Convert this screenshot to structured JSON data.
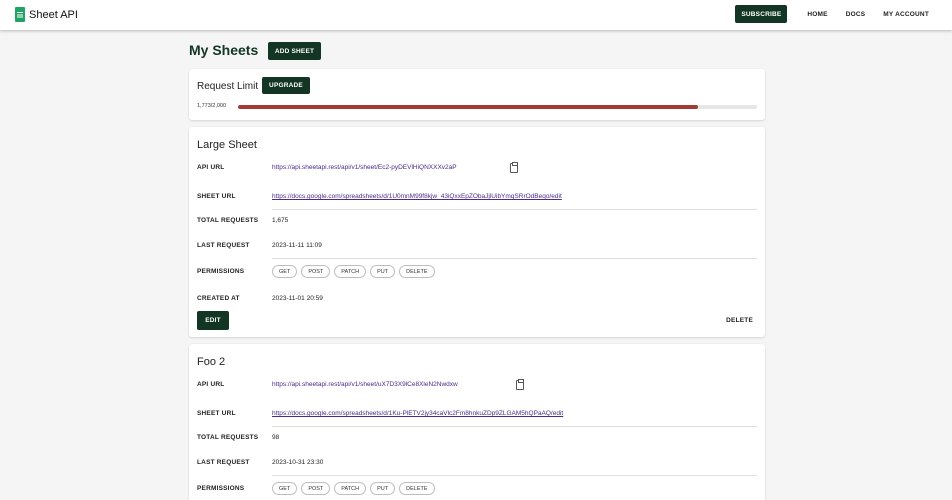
{
  "app": {
    "name": "Sheet API",
    "icon": "sheets-icon"
  },
  "nav": {
    "subscribe": "SUBSCRIBE",
    "home": "HOME",
    "docs": "DOCS",
    "account": "MY ACCOUNT"
  },
  "page": {
    "title": "My Sheets",
    "add_sheet": "ADD SHEET"
  },
  "limit": {
    "label": "Request Limit",
    "upgrade": "UPGRADE",
    "count_text": "1,773/2,000",
    "used": 1773,
    "max": 2000,
    "bar_color": "#a23a36"
  },
  "labels": {
    "api_url": "API URL",
    "sheet_url": "SHEET URL",
    "total_requests": "TOTAL REQUESTS",
    "last_request": "LAST REQUEST",
    "permissions": "PERMISSIONS",
    "created_at": "CREATED AT",
    "edit": "EDIT",
    "delete": "DELETE"
  },
  "sheets": [
    {
      "name": "Large Sheet",
      "api_url": "https://api.sheetapi.rest/api/v1/sheet/Ec2-pyDEVlHiQNXXXv2aP",
      "sheet_url": "https://docs.google.com/spreadsheets/d/1U0mnM99f8kjw_43iQxxEpZObaJjlUibYmqSRrOdBeqo/edit",
      "total_requests": "1,675",
      "last_request": "2023-11-11 11:09",
      "permissions": [
        "GET",
        "POST",
        "PATCH",
        "PUT",
        "DELETE"
      ],
      "created_at": "2023-11-01 20:59"
    },
    {
      "name": "Foo 2",
      "api_url": "https://api.sheetapi.rest/api/v1/sheet/uX7D3X9lCe8XleN2Nwdxw",
      "sheet_url": "https://docs.google.com/spreadsheets/d/1Ku-PlETV2jy34caVlc2Fm8hnkuZDp9ZLGAM5hQPaAQ/edit",
      "total_requests": "98",
      "last_request": "2023-10-31 23:30",
      "permissions": [
        "GET",
        "POST",
        "PATCH",
        "PUT",
        "DELETE"
      ]
    }
  ]
}
